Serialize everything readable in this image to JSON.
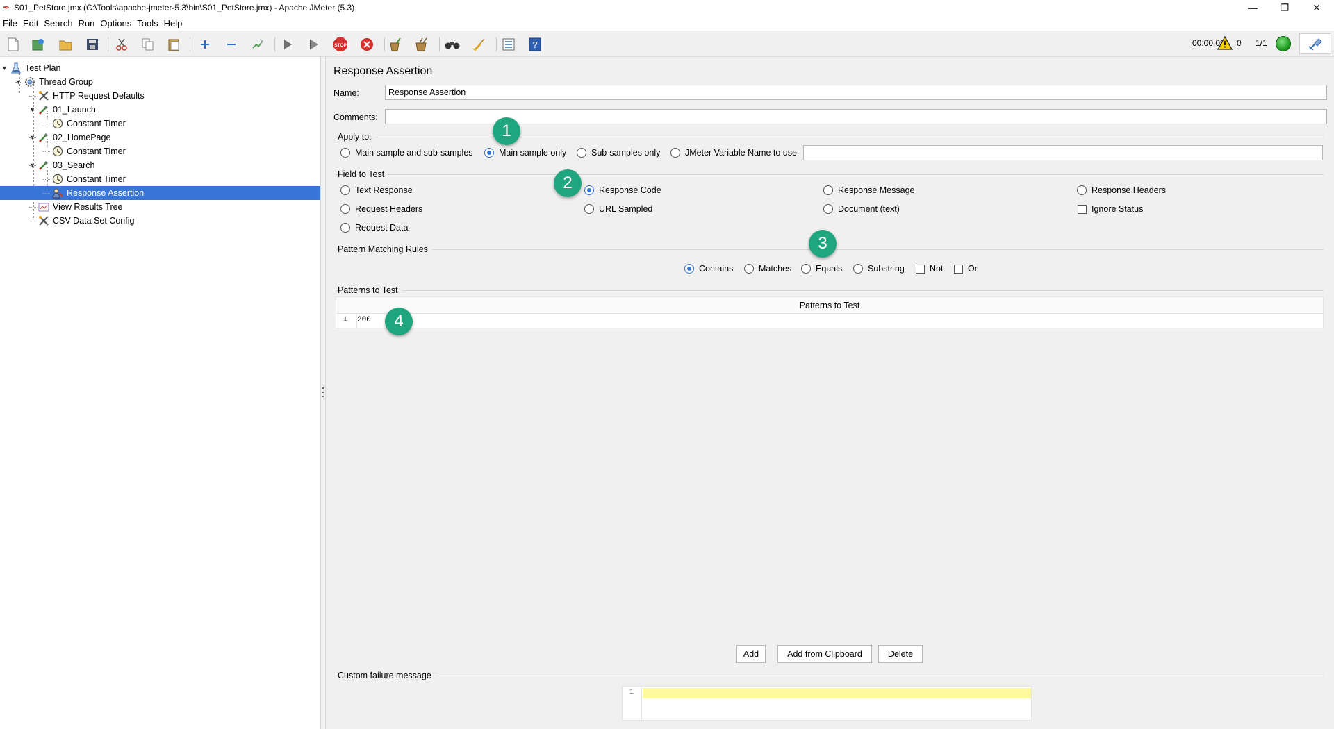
{
  "window": {
    "title": "S01_PetStore.jmx (C:\\Tools\\apache-jmeter-5.3\\bin\\S01_PetStore.jmx) - Apache JMeter (5.3)"
  },
  "menu": [
    "File",
    "Edit",
    "Search",
    "Run",
    "Options",
    "Tools",
    "Help"
  ],
  "toolbar": {
    "elapsed_time": "00:00:09",
    "warning_count": "0",
    "threads": "1/1",
    "status_color": "#1a9a1a"
  },
  "tree": [
    {
      "label": "Test Plan",
      "icon": "test-plan-icon",
      "depth": 0,
      "expanded": true
    },
    {
      "label": "Thread Group",
      "icon": "thread-group-icon",
      "depth": 1,
      "expanded": true
    },
    {
      "label": "HTTP Request Defaults",
      "icon": "config-element-icon",
      "depth": 2
    },
    {
      "label": "01_Launch",
      "icon": "http-sampler-icon",
      "depth": 2,
      "expanded": true
    },
    {
      "label": "Constant Timer",
      "icon": "timer-icon",
      "depth": 3
    },
    {
      "label": "02_HomePage",
      "icon": "http-sampler-icon",
      "depth": 2,
      "expanded": true
    },
    {
      "label": "Constant Timer",
      "icon": "timer-icon",
      "depth": 3
    },
    {
      "label": "03_Search",
      "icon": "http-sampler-icon",
      "depth": 2,
      "expanded": true
    },
    {
      "label": "Constant Timer",
      "icon": "timer-icon",
      "depth": 3
    },
    {
      "label": "Response Assertion",
      "icon": "assertion-icon",
      "depth": 3,
      "selected": true
    },
    {
      "label": "View Results Tree",
      "icon": "listener-icon",
      "depth": 2
    },
    {
      "label": "CSV Data Set Config",
      "icon": "config-element-icon",
      "depth": 2
    }
  ],
  "panel": {
    "title": "Response Assertion",
    "name_label": "Name:",
    "name_value": "Response Assertion",
    "comments_label": "Comments:",
    "comments_value": "",
    "apply_to": {
      "title": "Apply to:",
      "options": [
        "Main sample and sub-samples",
        "Main sample only",
        "Sub-samples only",
        "JMeter Variable Name to use"
      ],
      "selected": "Main sample only",
      "variable_value": ""
    },
    "field_to_test": {
      "title": "Field to Test",
      "options": [
        "Text Response",
        "Response Code",
        "Response Message",
        "Response Headers",
        "Request Headers",
        "URL Sampled",
        "Document (text)",
        "Request Data"
      ],
      "selected": "Response Code",
      "ignore_status_label": "Ignore Status",
      "ignore_status_checked": false
    },
    "pattern_matching": {
      "title": "Pattern Matching Rules",
      "options": [
        "Contains",
        "Matches",
        "Equals",
        "Substring"
      ],
      "selected": "Contains",
      "checkboxes": [
        {
          "label": "Not",
          "checked": false
        },
        {
          "label": "Or",
          "checked": false
        }
      ]
    },
    "patterns_to_test": {
      "title": "Patterns to Test",
      "column_header": "Patterns to Test",
      "line_number": "1",
      "value": "200"
    },
    "buttons": {
      "add": "Add",
      "add_from_clipboard": "Add from Clipboard",
      "delete": "Delete"
    },
    "custom_failure": {
      "title": "Custom failure message",
      "line_number": "1",
      "value": ""
    }
  },
  "annotations": [
    "1",
    "2",
    "3",
    "4"
  ],
  "colors": {
    "selection": "#3875d7",
    "badge": "#1fa67e",
    "highlight_line": "#fffa9c"
  }
}
